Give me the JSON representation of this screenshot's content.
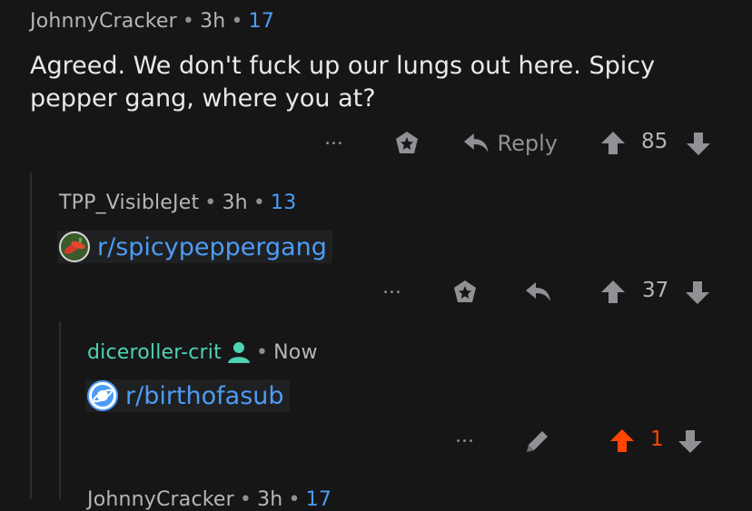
{
  "comments": [
    {
      "author": "JohnnyCracker",
      "time": "3h",
      "karma": "17",
      "text": "Agreed. We don't fuck up our lungs out here. Spicy pepper gang, where you at?",
      "reply_label": "Reply",
      "score": "85"
    },
    {
      "author": "TPP_VisibleJet",
      "time": "3h",
      "karma": "13",
      "subreddit_link": "r/spicypeppergang",
      "score": "37"
    },
    {
      "author": "diceroller-crit",
      "time": "Now",
      "subreddit_link": "r/birthofasub",
      "score": "1"
    },
    {
      "author": "JohnnyCracker",
      "time": "3h",
      "karma": "17"
    }
  ],
  "sep": "•",
  "more_label": "•••",
  "colors": {
    "background": "#161617",
    "link": "#4d9cf5",
    "op_author": "#4fd1b3",
    "upvoted": "#ff4500",
    "icon": "#8f9195"
  }
}
